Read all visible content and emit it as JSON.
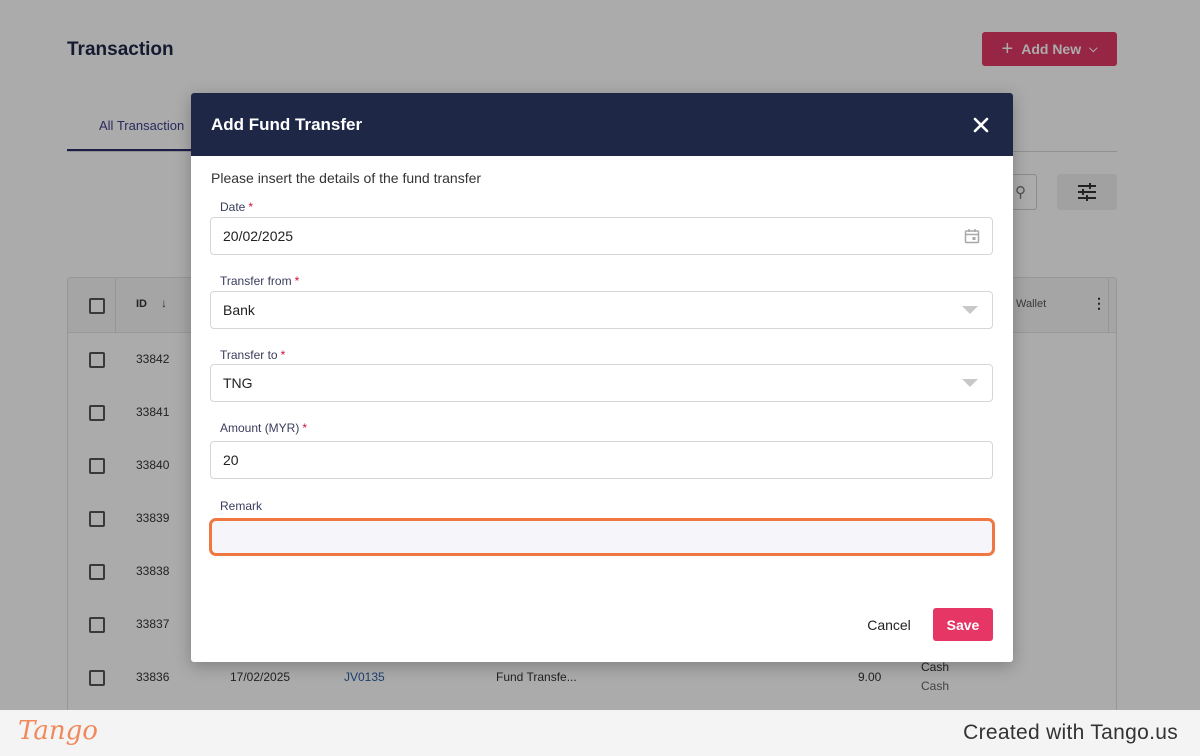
{
  "page": {
    "title": "Transaction",
    "add_new_label": "Add New",
    "tab_active": "All Transaction"
  },
  "table": {
    "header": {
      "id": "ID",
      "wallet": "Wallet"
    },
    "rows": [
      {
        "id": "33842"
      },
      {
        "id": "33841"
      },
      {
        "id": "33840"
      },
      {
        "id": "33839"
      },
      {
        "id": "33838"
      },
      {
        "id": "33837"
      },
      {
        "id": "33836",
        "date": "17/02/2025",
        "ref": "JV0135",
        "type": "Fund Transfe...",
        "amount": "9.00",
        "from": "Cash",
        "to": "Cash"
      }
    ]
  },
  "modal": {
    "title": "Add Fund Transfer",
    "description": "Please insert the details of the fund transfer",
    "date": {
      "label": "Date",
      "required": "*",
      "value": "20/02/2025"
    },
    "transfer_from": {
      "label": "Transfer from",
      "required": "*",
      "value": "Bank"
    },
    "transfer_to": {
      "label": "Transfer to",
      "required": "*",
      "value": "TNG"
    },
    "amount": {
      "label": "Amount (MYR)",
      "required": "*",
      "value": "20"
    },
    "remark": {
      "label": "Remark",
      "value": ""
    },
    "cancel_label": "Cancel",
    "save_label": "Save"
  },
  "footer": {
    "logo": "Tango",
    "created_with": "Created with Tango.us"
  },
  "colors": {
    "header_navy": "#1e2846",
    "accent_pink": "#e53665",
    "focus_orange": "#f07642"
  }
}
